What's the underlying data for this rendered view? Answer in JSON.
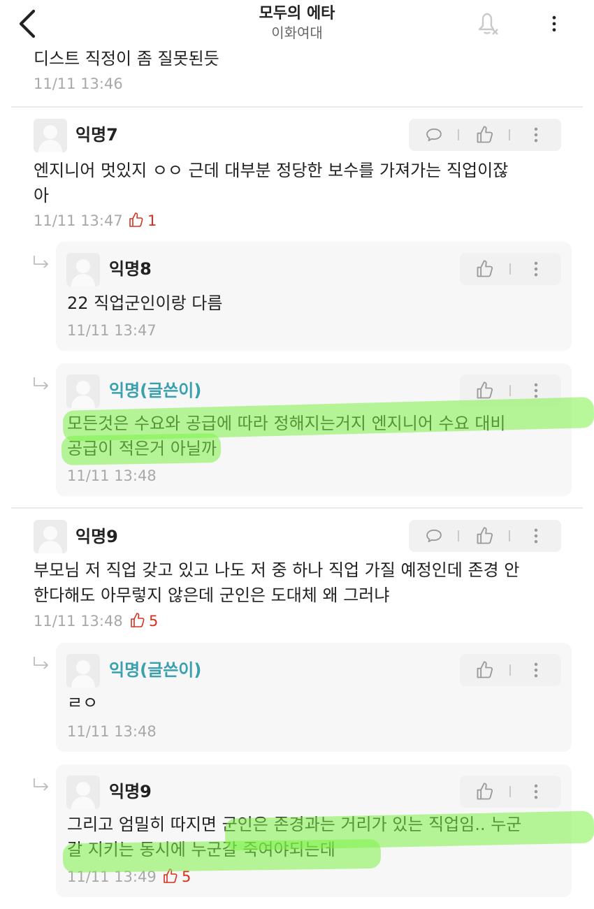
{
  "header": {
    "title": "모두의 에타",
    "subtitle": "이화여대"
  },
  "prev": {
    "text": "디스트 직정이 좀 질못된듯",
    "time": "11/11 13:46"
  },
  "comments": [
    {
      "name": "익명7",
      "body": "엔지니어 멋있지 ㅇㅇ 근데 대부분 정당한 보수를 가져가는 직업이잖",
      "body2": "아",
      "time": "11/11 13:47",
      "likes": "1"
    },
    {
      "name": "익명8",
      "body": "22 직업군인이랑 다름",
      "time": "11/11 13:47"
    },
    {
      "name": "익명(글쓴이)",
      "body": "모든것은 수요와 공급에 따라 정해지는거지 엔지니어 수요 대비",
      "body2": "공급이 적은거 아닐까",
      "time": "11/11 13:48"
    },
    {
      "name": "익명9",
      "body": "부모님 저 직업 갖고 있고 나도 저 중 하나 직업 가질 예정인데 존경 안",
      "body2": "한다해도 아무렇지 않은데 군인은 도대체 왜 그러냐",
      "time": "11/11 13:48",
      "likes": "5"
    },
    {
      "name": "익명(글쓴이)",
      "body": "ㄹㅇ",
      "time": "11/11 13:48"
    },
    {
      "name": "익명9",
      "body": "그리고 엄밀히 따지면 군인은 존경과는 거리가 있는 직업임.. 누군",
      "body2": "갈 지키는 동시에 누군갈 죽여야되는데",
      "time": "11/11 13:49",
      "likes": "5"
    }
  ],
  "colors": {
    "accent_name": "#3aa0b0",
    "like": "#d8301f",
    "highlight": "#7ef248"
  }
}
